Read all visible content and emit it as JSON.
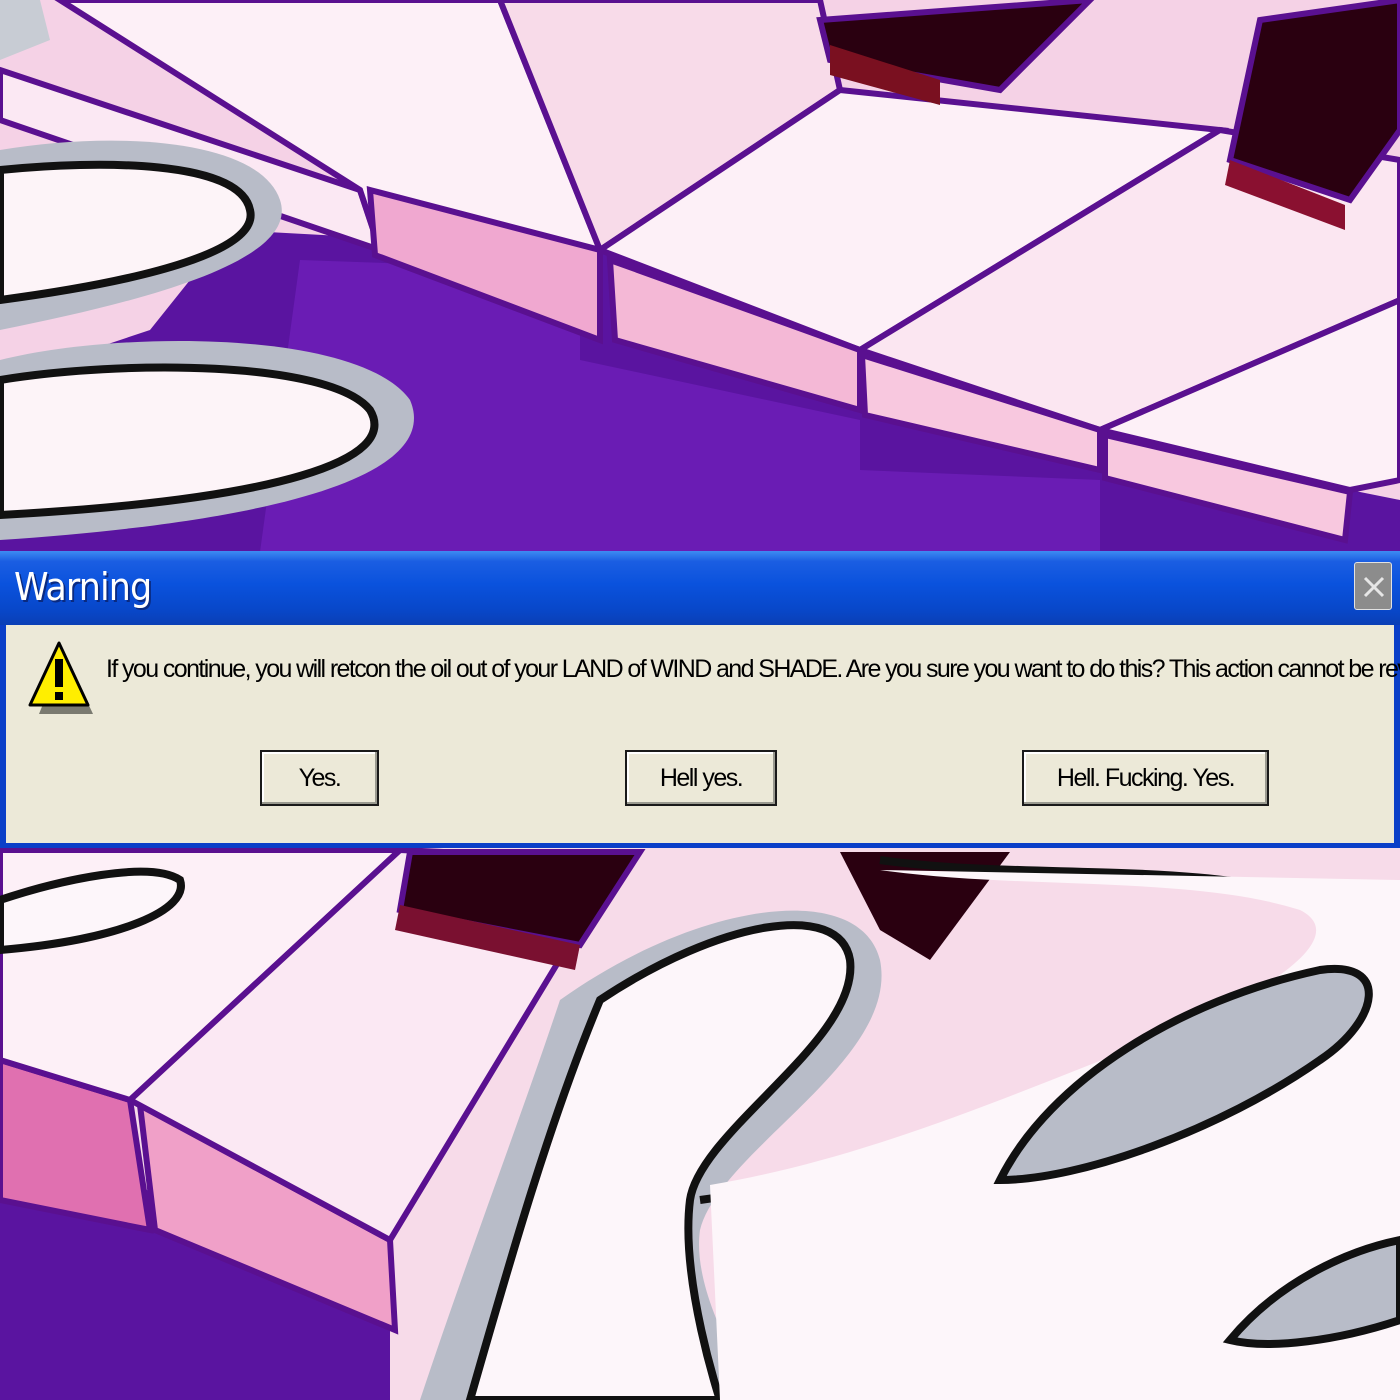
{
  "dialog": {
    "title": "Warning",
    "close_icon": "close-icon",
    "warning_icon": "warning-triangle-icon",
    "message": "If you continue, you will retcon the oil out of your LAND of WIND and SHADE. Are you sure you want to do this? This action cannot be reverted.",
    "buttons": {
      "yes": "Yes.",
      "hell_yes": "Hell yes.",
      "hell_fucking_yes": "Hell. Fucking. Yes."
    }
  },
  "colors": {
    "titlebar_blue": "#0a52dd",
    "dialog_body": "#ece9d8",
    "warning_yellow": "#ffee00",
    "background_purple": "#5a14a0",
    "background_pink": "#f6d3e8"
  },
  "background": {
    "subject": "piano keys and hands illustration"
  }
}
